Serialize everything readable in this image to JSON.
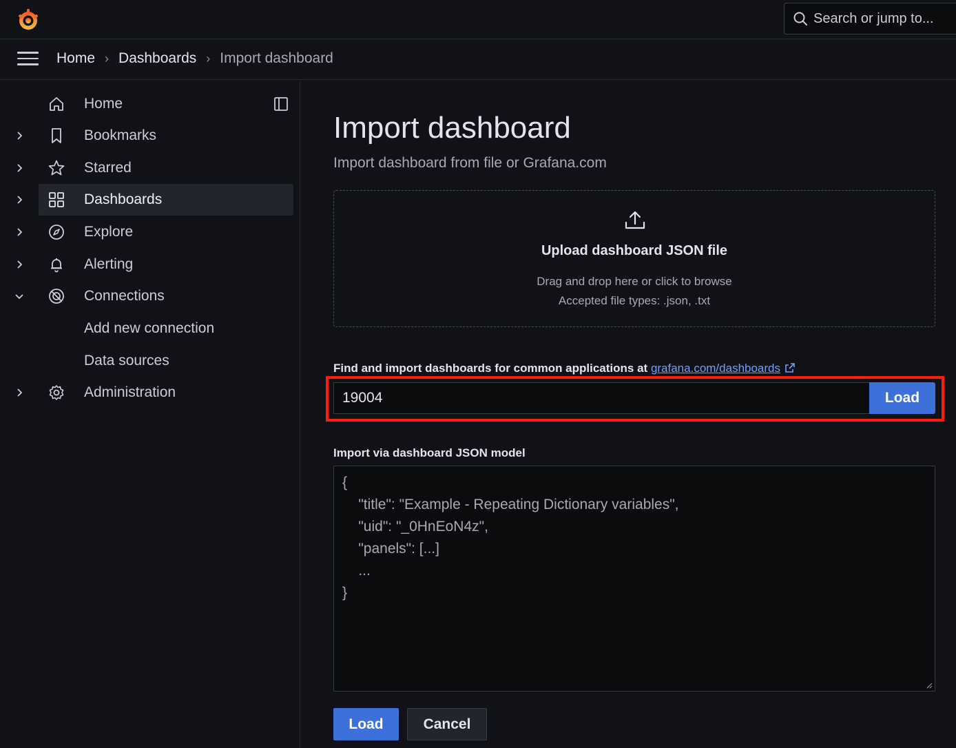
{
  "header": {
    "logo_icon": "grafana-logo",
    "search": {
      "placeholder": "Search or jump to...",
      "icon": "search-icon"
    }
  },
  "breadcrumb": {
    "items": [
      "Home",
      "Dashboards",
      "Import dashboard"
    ]
  },
  "sidebar": {
    "items": [
      {
        "label": "Home",
        "icon": "home-icon"
      },
      {
        "label": "Bookmarks",
        "icon": "bookmark-icon"
      },
      {
        "label": "Starred",
        "icon": "star-icon"
      },
      {
        "label": "Dashboards",
        "icon": "apps-icon",
        "active": true
      },
      {
        "label": "Explore",
        "icon": "compass-icon"
      },
      {
        "label": "Alerting",
        "icon": "bell-icon"
      },
      {
        "label": "Connections",
        "icon": "connections-icon",
        "expanded": true
      },
      {
        "label": "Administration",
        "icon": "cog-icon"
      }
    ],
    "sub_items": [
      "Add new connection",
      "Data sources"
    ]
  },
  "main": {
    "title": "Import dashboard",
    "subtitle": "Import dashboard from file or Grafana.com",
    "upload": {
      "title": "Upload dashboard JSON file",
      "line1": "Drag and drop here or click to browse",
      "line2": "Accepted file types: .json, .txt"
    },
    "grafana_com": {
      "label": "Find and import dashboards for common applications at",
      "link": "grafana.com/dashboards",
      "value": "19004",
      "load_label": "Load"
    },
    "json_model": {
      "label": "Import via dashboard JSON model",
      "placeholder": "{\n    \"title\": \"Example - Repeating Dictionary variables\",\n    \"uid\": \"_0HnEoN4z\",\n    \"panels\": [...]\n    ...\n}"
    },
    "actions": {
      "load": "Load",
      "cancel": "Cancel"
    }
  },
  "colors": {
    "accent": "#3d71d9",
    "highlight": "#ff1a0a",
    "active_indicator": "#f55f3e",
    "link": "#6e9fff"
  }
}
